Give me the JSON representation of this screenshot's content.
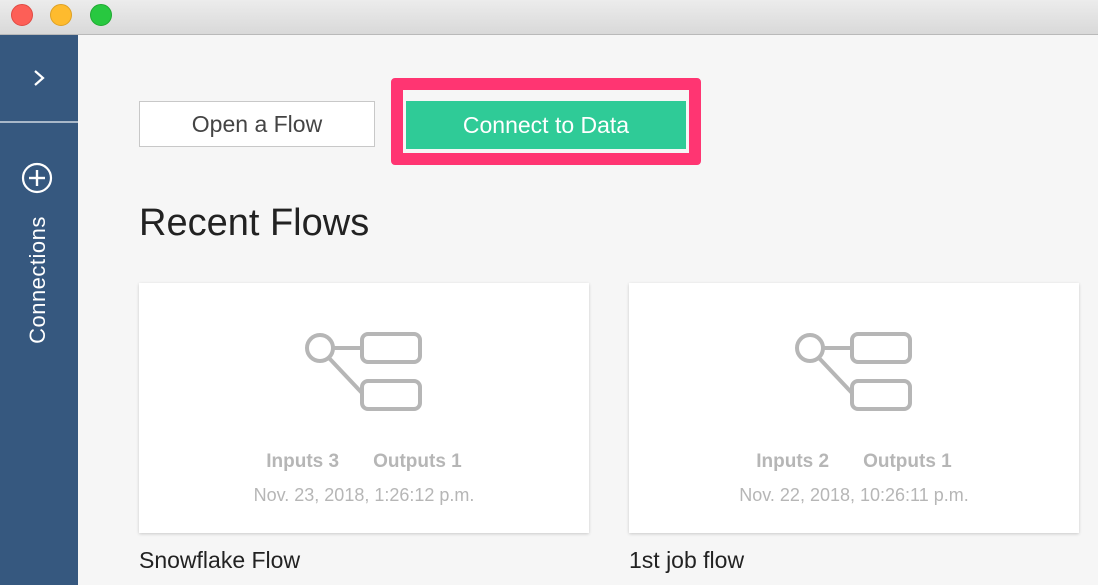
{
  "window": {
    "traffic_lights": [
      "close",
      "minimize",
      "zoom"
    ]
  },
  "sidebar": {
    "toggle_icon": "chevron-right-icon",
    "add_icon": "plus-circle-icon",
    "connections_label": "Connections",
    "background": "#36587f"
  },
  "actions": {
    "open_flow_label": "Open a Flow",
    "connect_label": "Connect to Data",
    "connect_color": "#2fcb97",
    "highlight_color": "#ff3572"
  },
  "recent": {
    "heading": "Recent Flows",
    "flows": [
      {
        "name": "Snowflake Flow",
        "inputs_label": "Inputs 3",
        "outputs_label": "Outputs 1",
        "date": "Nov. 23, 2018, 1:26:12 p.m.",
        "icon": "flow-diagram-icon"
      },
      {
        "name": "1st job flow",
        "inputs_label": "Inputs 2",
        "outputs_label": "Outputs 1",
        "date": "Nov. 22, 2018, 10:26:11 p.m.",
        "icon": "flow-diagram-icon"
      }
    ]
  }
}
